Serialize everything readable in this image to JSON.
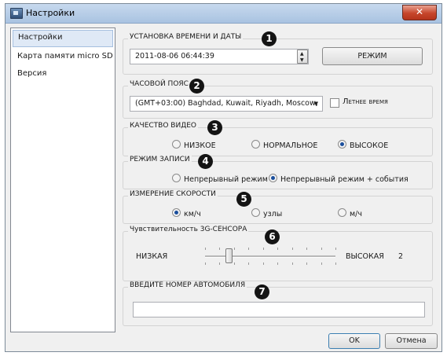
{
  "window": {
    "title": "Настройки",
    "close_label": "✕"
  },
  "sidebar": {
    "items": [
      {
        "label": "Настройки",
        "selected": true
      },
      {
        "label": "Карта памяти micro SD",
        "selected": false
      },
      {
        "label": "Версия",
        "selected": false
      }
    ]
  },
  "time": {
    "legend": "УСТАНОВКА ВРЕМЕНИ И ДАТЫ",
    "badge": "1",
    "value": "2011-08-06 06:44:39",
    "mode_button": "РЕЖИМ"
  },
  "timezone": {
    "legend": "ЧАСОВОЙ ПОЯС",
    "badge": "2",
    "selected": "(GMT+03:00) Baghdad, Kuwait, Riyadh, Moscow,",
    "dst_label": "Летнее время",
    "dst_checked": false
  },
  "video_quality": {
    "legend": "КАЧЕСТВО ВИДЕО",
    "badge": "3",
    "options": [
      "НИЗКОЕ",
      "НОРМАЛЬНОЕ",
      "ВЫСОКОЕ"
    ],
    "selected": "ВЫСОКОЕ"
  },
  "record_mode": {
    "legend": "РЕЖИМ ЗАПИСИ",
    "badge": "4",
    "options": [
      "Непрерывный режим",
      "Непрерывный режим + события"
    ],
    "selected": "Непрерывный режим + события"
  },
  "speed": {
    "legend": "ИЗМЕРЕНИЕ СКОРОСТИ",
    "badge": "5",
    "options": [
      "км/ч",
      "узлы",
      "м/ч"
    ],
    "selected": "км/ч"
  },
  "sensor": {
    "legend": "Чувствительность 3G-СЕНСОРА",
    "badge": "6",
    "low_label": "НИЗКАЯ",
    "high_label": "ВЫСОКАЯ",
    "value": "2",
    "level": 2,
    "min": 1,
    "max": 10
  },
  "vehicle": {
    "legend": "ВВЕДИТЕ НОМЕР АВТОМОБИЛЯ",
    "badge": "7",
    "value": ""
  },
  "footer": {
    "ok_label": "OK",
    "cancel_label": "Отмена"
  },
  "colors": {
    "accent": "#1a4e9c",
    "title_gradient": "#a9c3e1",
    "close": "#c6452b"
  }
}
